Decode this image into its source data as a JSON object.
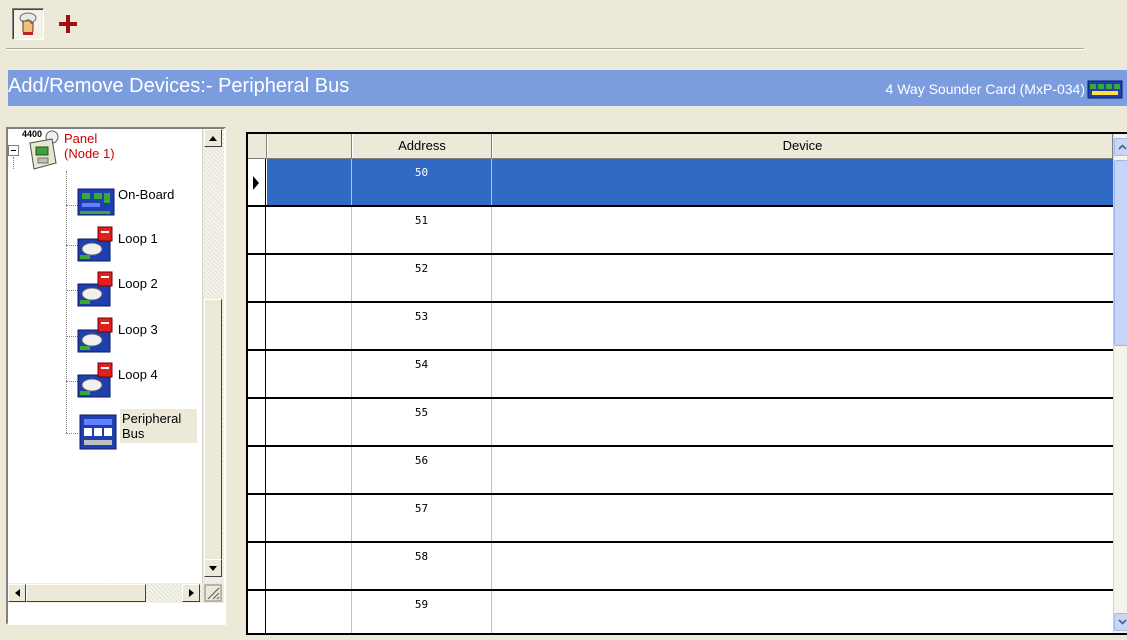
{
  "toolbar": {
    "buttons": [
      {
        "name": "hand-pointer-button",
        "icon": "hand-icon"
      },
      {
        "name": "add-button",
        "icon": "plus-icon"
      }
    ]
  },
  "title_bar": {
    "title": "Add/Remove Devices:- Peripheral Bus",
    "device_label": "4 Way Sounder Card (MxP-034)",
    "icon": "sounder-card-icon"
  },
  "tree": {
    "panel": {
      "badge": "4400",
      "label": "Panel\n(Node 1)",
      "icon": "panel-icon"
    },
    "items": [
      {
        "label": "On-Board",
        "icon": "circuit-board-icon"
      },
      {
        "label": "Loop 1",
        "icon": "loop-icon"
      },
      {
        "label": "Loop 2",
        "icon": "loop-icon"
      },
      {
        "label": "Loop 3",
        "icon": "loop-icon"
      },
      {
        "label": "Loop 4",
        "icon": "loop-icon"
      },
      {
        "label": "Peripheral\nBus",
        "icon": "peripheral-bus-icon"
      }
    ]
  },
  "grid": {
    "columns": [
      "",
      "Address",
      "Device"
    ],
    "rows": [
      {
        "address": "50",
        "device": ""
      },
      {
        "address": "51",
        "device": ""
      },
      {
        "address": "52",
        "device": ""
      },
      {
        "address": "53",
        "device": ""
      },
      {
        "address": "54",
        "device": ""
      },
      {
        "address": "55",
        "device": ""
      },
      {
        "address": "56",
        "device": ""
      },
      {
        "address": "57",
        "device": ""
      },
      {
        "address": "58",
        "device": ""
      },
      {
        "address": "59",
        "device": ""
      }
    ],
    "selected_row": 0
  },
  "colors": {
    "title_bar": "#7b9ddf",
    "selection": "#316ac5",
    "panel_label": "#d00000",
    "loop_icon_red": "#e02020",
    "board_blue": "#1f3fb0"
  }
}
